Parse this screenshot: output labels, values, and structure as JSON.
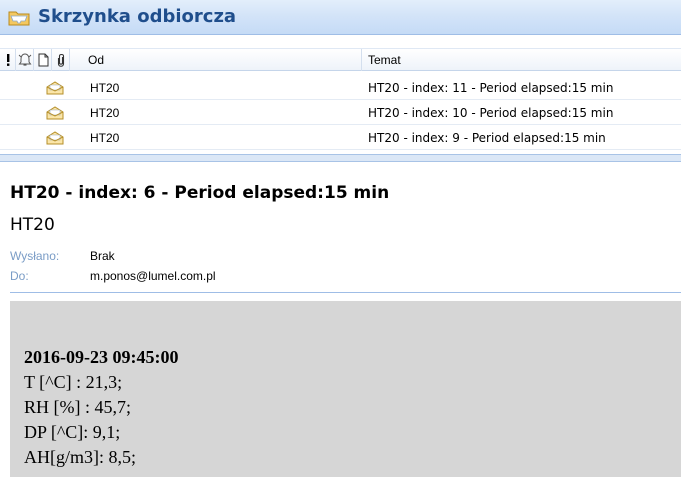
{
  "window": {
    "title": "Skrzynka odbiorcza"
  },
  "columns": {
    "from": "Od",
    "subject": "Temat"
  },
  "messages": [
    {
      "from": "HT20",
      "subject": "HT20 - index: 11 - Period elapsed:15 min"
    },
    {
      "from": "HT20",
      "subject": "HT20 - index: 10 - Period elapsed:15 min"
    },
    {
      "from": "HT20",
      "subject": "HT20 - index: 9 - Period elapsed:15 min"
    }
  ],
  "reading_pane": {
    "subject": "HT20 - index: 6 - Period elapsed:15 min",
    "from": "HT20",
    "sent_label": "Wysłano:",
    "sent_value": "Brak",
    "to_label": "Do:",
    "to_value": "m.ponos@lumel.com.pl",
    "body": {
      "timestamp": "2016-09-23 09:45:00",
      "t": "T [^C] : 21,3;",
      "rh": "RH [%] : 45,7;",
      "dp": "DP [^C]: 9,1;",
      "ah": "AH[g/m3]: 8,5;"
    }
  },
  "colors": {
    "title": "#1f4e8c",
    "header_blue": "#c5dbf6",
    "label_blue": "#7a9cc6",
    "body_bg": "#d6d6d6"
  },
  "icons": {
    "title": "inbox-folder-icon",
    "importance": "importance-icon",
    "reminder": "reminder-bell-icon",
    "type": "document-icon",
    "attachment": "paperclip-icon",
    "message": "opened-envelope-icon"
  }
}
